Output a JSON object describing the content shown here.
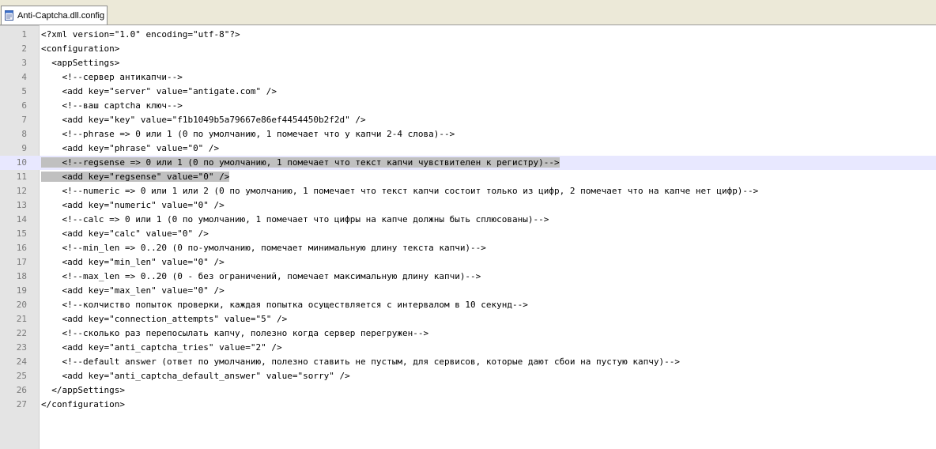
{
  "tab": {
    "label": "Anti-Captcha.dll.config",
    "icon": "xml-file-icon"
  },
  "colors": {
    "selection": "#c0c0c0",
    "current_line": "#e8e8ff",
    "gutter": "#e4e4e4"
  },
  "editor": {
    "lines": [
      {
        "num": "1",
        "pre": "",
        "sel": "",
        "text": "<?xml version=\"1.0\" encoding=\"utf-8\"?>"
      },
      {
        "num": "2",
        "pre": "",
        "sel": "",
        "text": "<configuration>"
      },
      {
        "num": "3",
        "pre": "  ",
        "sel": "",
        "text": "<appSettings>"
      },
      {
        "num": "4",
        "pre": "    ",
        "sel": "",
        "text": "<!--сервер антикапчи-->"
      },
      {
        "num": "5",
        "pre": "    ",
        "sel": "",
        "text": "<add key=\"server\" value=\"antigate.com\" />"
      },
      {
        "num": "6",
        "pre": "    ",
        "sel": "",
        "text": "<!--ваш captcha ключ-->"
      },
      {
        "num": "7",
        "pre": "    ",
        "sel": "",
        "text": "<add key=\"key\" value=\"f1b1049b5a79667e86ef4454450b2f2d\" />"
      },
      {
        "num": "8",
        "pre": "    ",
        "sel": "",
        "text": "<!--phrase => 0 или 1 (0 по умолчанию, 1 помечает что у капчи 2-4 слова)-->"
      },
      {
        "num": "9",
        "pre": "    ",
        "sel": "",
        "text": "<add key=\"phrase\" value=\"0\" />"
      },
      {
        "num": "10",
        "pre": "",
        "sel": "    <!--regsense => 0 или 1 (0 по умолчанию, 1 помечает что текст капчи чувствителен к регистру)-->",
        "text": ""
      },
      {
        "num": "11",
        "pre": "",
        "sel": "    <add key=\"regsense\" value=\"0\" />",
        "text": ""
      },
      {
        "num": "12",
        "pre": "    ",
        "sel": "",
        "text": "<!--numeric => 0 или 1 или 2 (0 по умолчанию, 1 помечает что текст капчи состоит только из цифр, 2 помечает что на капче нет цифр)-->"
      },
      {
        "num": "13",
        "pre": "    ",
        "sel": "",
        "text": "<add key=\"numeric\" value=\"0\" />"
      },
      {
        "num": "14",
        "pre": "    ",
        "sel": "",
        "text": "<!--calc => 0 или 1 (0 по умолчанию, 1 помечает что цифры на капче должны быть сплюсованы)-->"
      },
      {
        "num": "15",
        "pre": "    ",
        "sel": "",
        "text": "<add key=\"calc\" value=\"0\" />"
      },
      {
        "num": "16",
        "pre": "    ",
        "sel": "",
        "text": "<!--min_len => 0..20 (0 по-умолчанию, помечает минимальную длину текста капчи)-->"
      },
      {
        "num": "17",
        "pre": "    ",
        "sel": "",
        "text": "<add key=\"min_len\" value=\"0\" />"
      },
      {
        "num": "18",
        "pre": "    ",
        "sel": "",
        "text": "<!--max_len => 0..20 (0 - без ограничений, помечает максимальную длину капчи)-->"
      },
      {
        "num": "19",
        "pre": "    ",
        "sel": "",
        "text": "<add key=\"max_len\" value=\"0\" />"
      },
      {
        "num": "20",
        "pre": "    ",
        "sel": "",
        "text": "<!--колчиство попыток проверки, каждая попытка осуществляется с интервалом в 10 секунд-->"
      },
      {
        "num": "21",
        "pre": "    ",
        "sel": "",
        "text": "<add key=\"connection_attempts\" value=\"5\" />"
      },
      {
        "num": "22",
        "pre": "    ",
        "sel": "",
        "text": "<!--сколько раз перепосылать капчу, полезно когда сервер перегружен-->"
      },
      {
        "num": "23",
        "pre": "    ",
        "sel": "",
        "text": "<add key=\"anti_captcha_tries\" value=\"2\" />"
      },
      {
        "num": "24",
        "pre": "    ",
        "sel": "",
        "text": "<!--default answer (ответ по умолчанию, полезно ставить не пустым, для сервисов, которые дают сбои на пустую капчу)-->"
      },
      {
        "num": "25",
        "pre": "    ",
        "sel": "",
        "text": "<add key=\"anti_captcha_default_answer\" value=\"sorry\" />"
      },
      {
        "num": "26",
        "pre": "  ",
        "sel": "",
        "text": "</appSettings>"
      },
      {
        "num": "27",
        "pre": "",
        "sel": "",
        "text": "</configuration>"
      }
    ]
  }
}
